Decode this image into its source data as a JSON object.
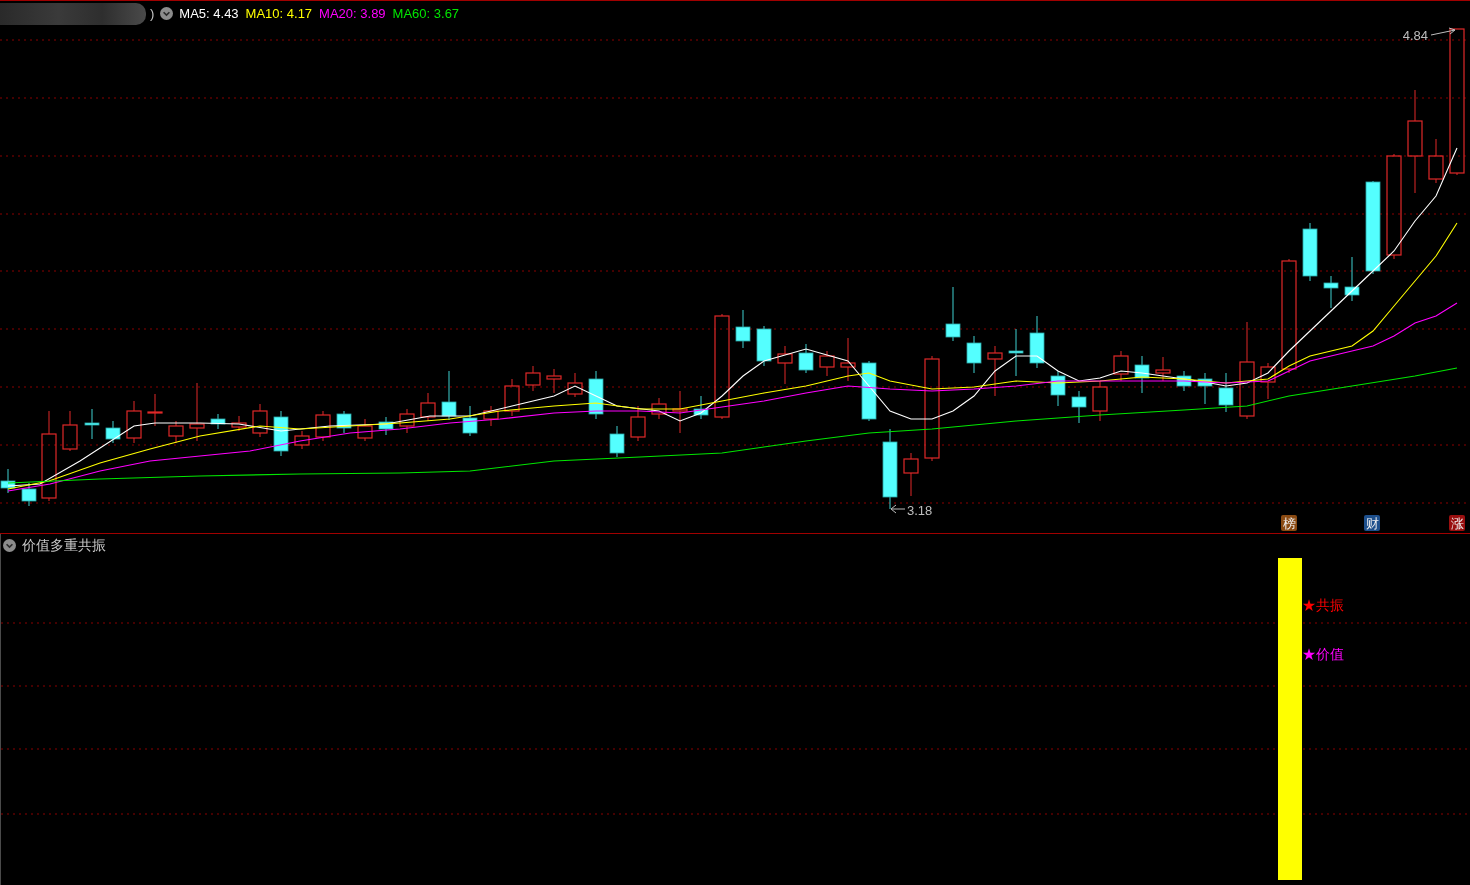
{
  "header": {
    "title_tail": ")",
    "ma_readings": [
      {
        "label": "MA5: 4.43",
        "color": "#ffffff"
      },
      {
        "label": "MA10: 4.17",
        "color": "#ffff00"
      },
      {
        "label": "MA20: 3.89",
        "color": "#ff00ff"
      },
      {
        "label": "MA60: 3.67",
        "color": "#00e600"
      }
    ]
  },
  "main_chart": {
    "high_label": "4.84",
    "low_label": "3.18",
    "badges": [
      {
        "label": "榜",
        "color": "#8a4a12"
      },
      {
        "label": "财",
        "color": "#1d4f8c"
      },
      {
        "label": "涨",
        "color": "#9a0f0f"
      }
    ]
  },
  "indicator_panel": {
    "title": "价值多重共振",
    "signals": [
      {
        "label": "★共振",
        "color": "#ff0000"
      },
      {
        "label": "★价值",
        "color": "#ff00ff"
      }
    ]
  }
}
